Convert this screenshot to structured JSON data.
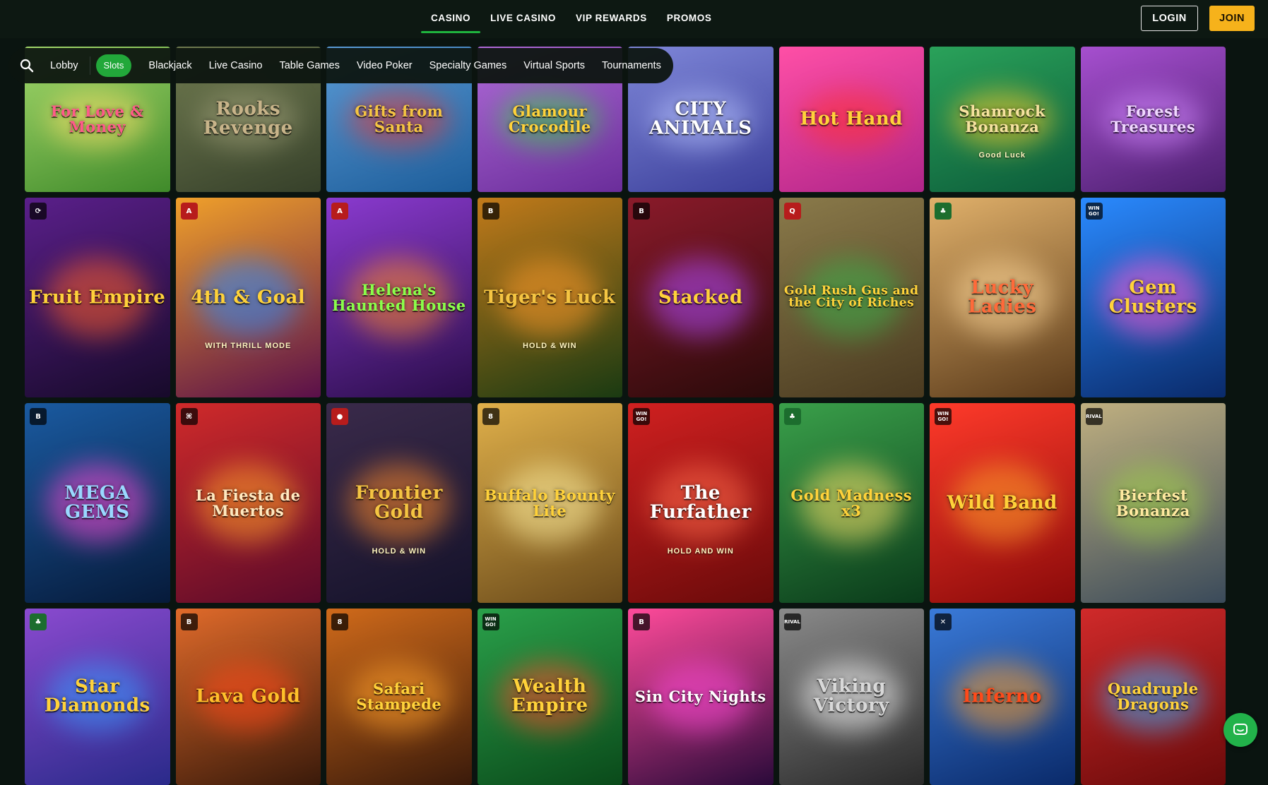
{
  "nav": {
    "items": [
      {
        "label": "CASINO",
        "active": true
      },
      {
        "label": "LIVE CASINO",
        "active": false
      },
      {
        "label": "VIP REWARDS",
        "active": false
      },
      {
        "label": "PROMOS",
        "active": false
      }
    ],
    "login_label": "LOGIN",
    "join_label": "JOIN"
  },
  "categories": {
    "search_icon": "search-icon",
    "lobby": "Lobby",
    "active": "Slots",
    "items": [
      "Blackjack",
      "Live Casino",
      "Table Games",
      "Video Poker",
      "Specialty Games",
      "Virtual Sports",
      "Tournaments"
    ]
  },
  "games": [
    {
      "title": "For Love & Money",
      "sub": "",
      "badge": "",
      "colors": [
        "#3f8a2a",
        "#a3d86b"
      ],
      "text": "#ff5a8a",
      "glow": "#ffe36a"
    },
    {
      "title": "Rooks Revenge",
      "sub": "",
      "badge": "",
      "colors": [
        "#36402a",
        "#6f7a4f"
      ],
      "text": "#c8b48a",
      "glow": "#a1a17a"
    },
    {
      "title": "Gifts from Santa",
      "sub": "",
      "badge": "",
      "colors": [
        "#1d5d9a",
        "#5a9bd6"
      ],
      "text": "#f5c542",
      "glow": "#e33b3b"
    },
    {
      "title": "Glamour Crocodile",
      "sub": "",
      "badge": "",
      "colors": [
        "#6a2d9a",
        "#b06ad9"
      ],
      "text": "#ffd23a",
      "glow": "#3bd04a"
    },
    {
      "title": "CITY ANIMALS",
      "sub": "",
      "badge": "",
      "colors": [
        "#3b3f9a",
        "#7e86d8"
      ],
      "text": "#ffffff",
      "glow": "#b8c4ff"
    },
    {
      "title": "Hot Hand",
      "sub": "",
      "badge": "",
      "colors": [
        "#b0258a",
        "#ff4fa6"
      ],
      "text": "#ffd23a",
      "glow": "#ff3030"
    },
    {
      "title": "Shamrock Bonanza",
      "sub": "Good Luck",
      "badge": "",
      "colors": [
        "#0c5c3a",
        "#2aa25a"
      ],
      "text": "#f6e2a0",
      "glow": "#ffcf2a"
    },
    {
      "title": "Forest Treasures",
      "sub": "",
      "badge": "",
      "colors": [
        "#4b1f6e",
        "#a64fcf"
      ],
      "text": "#f0d8ff",
      "glow": "#d38aff"
    },
    {
      "title": "Fruit Empire",
      "sub": "",
      "badge": "⟳",
      "badgeClass": "",
      "colors": [
        "#170a2a",
        "#5a1f8a"
      ],
      "text": "#ffd23a",
      "glow": "#ff5e2a"
    },
    {
      "title": "4th & Goal",
      "sub": "WITH THRILL MODE",
      "badge": "A",
      "badgeClass": "red",
      "colors": [
        "#5a0f4a",
        "#f0a02a"
      ],
      "text": "#ffd23a",
      "glow": "#2a8aff"
    },
    {
      "title": "Helena's Haunted House",
      "sub": "",
      "badge": "A",
      "badgeClass": "red",
      "colors": [
        "#2a0d4a",
        "#8a3acf"
      ],
      "text": "#8aff4a",
      "glow": "#ff8a2a"
    },
    {
      "title": "Tiger's Luck",
      "sub": "HOLD & WIN",
      "badge": "B",
      "badgeClass": "",
      "colors": [
        "#1a3a12",
        "#c27a1a"
      ],
      "text": "#f5c542",
      "glow": "#ff9a2a"
    },
    {
      "title": "Stacked",
      "sub": "",
      "badge": "B",
      "badgeClass": "",
      "colors": [
        "#2a0a0a",
        "#8a1a2a"
      ],
      "text": "#ffd23a",
      "glow": "#b04aff"
    },
    {
      "title": "Gold Rush Gus and the City of Riches",
      "sub": "",
      "badge": "Q",
      "badgeClass": "red",
      "colors": [
        "#4a3a20",
        "#8a7a4a"
      ],
      "text": "#ffd23a",
      "glow": "#3ab04a"
    },
    {
      "title": "Lucky Ladies",
      "sub": "",
      "badge": "♣",
      "badgeClass": "green",
      "colors": [
        "#5a3a1a",
        "#e0b06a"
      ],
      "text": "#ff6a3a",
      "glow": "#ffd89a"
    },
    {
      "title": "Gem Clusters",
      "sub": "",
      "badge": "WIN GO!",
      "badgeClass": "",
      "colors": [
        "#0a2a6a",
        "#2a8aff"
      ],
      "text": "#ffd23a",
      "glow": "#ff5ad8"
    },
    {
      "title": "MEGA GEMS",
      "sub": "",
      "badge": "B",
      "badgeClass": "",
      "colors": [
        "#061a3a",
        "#1a5aa0"
      ],
      "text": "#9ad8ff",
      "glow": "#ff4ad8"
    },
    {
      "title": "La Fiesta de Muertos",
      "sub": "",
      "badge": "⌘",
      "badgeClass": "",
      "colors": [
        "#5a0a2a",
        "#d02a2a"
      ],
      "text": "#ffe9c0",
      "glow": "#ffa02a"
    },
    {
      "title": "Frontier Gold",
      "sub": "HOLD & WIN",
      "badge": "●",
      "badgeClass": "red",
      "colors": [
        "#14122a",
        "#3a2a4a"
      ],
      "text": "#f5c542",
      "glow": "#ff8a2a"
    },
    {
      "title": "Buffalo Bounty Lite",
      "sub": "",
      "badge": "8",
      "badgeClass": "",
      "colors": [
        "#6a4a1a",
        "#e0b04a"
      ],
      "text": "#ffd23a",
      "glow": "#fff0a0"
    },
    {
      "title": "The Furfather",
      "sub": "HOLD AND WIN",
      "badge": "WIN GO!",
      "badgeClass": "",
      "colors": [
        "#6a0a0a",
        "#d02020"
      ],
      "text": "#ffffff",
      "glow": "#ff6a4a"
    },
    {
      "title": "Gold Madness x3",
      "sub": "",
      "badge": "♣",
      "badgeClass": "green",
      "colors": [
        "#0a3a1a",
        "#3aa04a"
      ],
      "text": "#ffd23a",
      "glow": "#ffe36a"
    },
    {
      "title": "Wild Band",
      "sub": "",
      "badge": "WIN GO!",
      "badgeClass": "",
      "colors": [
        "#8a0a0a",
        "#ff3a2a"
      ],
      "text": "#ffd23a",
      "glow": "#ffa02a"
    },
    {
      "title": "Bierfest Bonanza",
      "sub": "",
      "badge": "RIVAL",
      "badgeClass": "",
      "colors": [
        "#3a4a5a",
        "#c0b080"
      ],
      "text": "#ffe9a0",
      "glow": "#a0d04a"
    },
    {
      "title": "Star Diamonds",
      "sub": "",
      "badge": "♣",
      "badgeClass": "green",
      "colors": [
        "#2a2a8a",
        "#8a4acf"
      ],
      "text": "#ffd23a",
      "glow": "#3a9aff"
    },
    {
      "title": "Lava Gold",
      "sub": "",
      "badge": "B",
      "badgeClass": "",
      "colors": [
        "#3a1a0a",
        "#e06a2a"
      ],
      "text": "#ffc02a",
      "glow": "#ff4a1a"
    },
    {
      "title": "Safari Stampede",
      "sub": "",
      "badge": "8",
      "badgeClass": "",
      "colors": [
        "#3a1a0a",
        "#d06a1a"
      ],
      "text": "#ffd23a",
      "glow": "#ffa02a"
    },
    {
      "title": "Wealth Empire",
      "sub": "",
      "badge": "WIN GO!",
      "badgeClass": "",
      "colors": [
        "#0a4a1a",
        "#2aa04a"
      ],
      "text": "#ffd23a",
      "glow": "#ff4a2a"
    },
    {
      "title": "Sin City Nights",
      "sub": "",
      "badge": "B",
      "badgeClass": "",
      "colors": [
        "#2a0a3a",
        "#ff4a9a"
      ],
      "text": "#ffffff",
      "glow": "#ff4ad8"
    },
    {
      "title": "Viking Victory",
      "sub": "",
      "badge": "RIVAL",
      "badgeClass": "",
      "colors": [
        "#2a2a2a",
        "#8a8a8a"
      ],
      "text": "#d8d8d8",
      "glow": "#ffffff"
    },
    {
      "title": "Inferno",
      "sub": "",
      "badge": "✕",
      "badgeClass": "",
      "colors": [
        "#0a2a6a",
        "#3a7ad8"
      ],
      "text": "#ff4a1a",
      "glow": "#ffa02a"
    },
    {
      "title": "Quadruple Dragons",
      "sub": "",
      "badge": "",
      "colors": [
        "#6a0a0a",
        "#d02a2a"
      ],
      "text": "#ffd23a",
      "glow": "#3ab0ff"
    }
  ]
}
